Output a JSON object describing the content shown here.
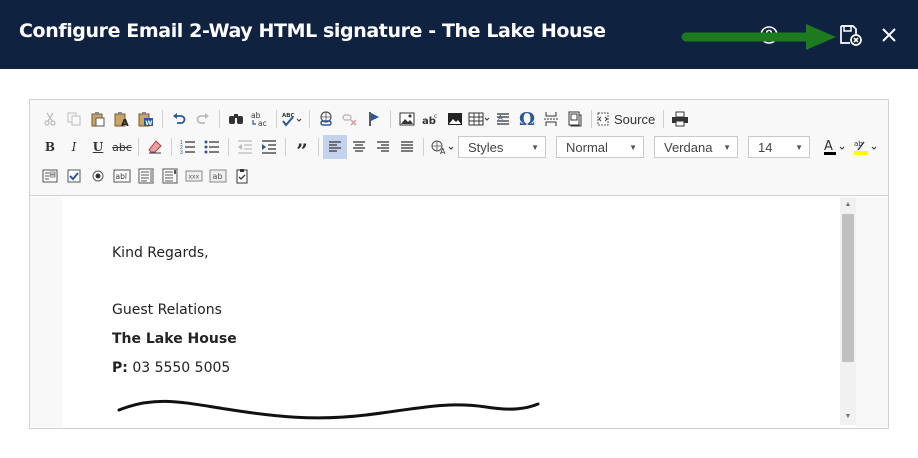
{
  "header": {
    "title": "Configure Email 2-Way HTML signature - The Lake House",
    "background": "#0f2340",
    "icons": [
      "help-icon",
      "save-close-icon",
      "close-icon"
    ],
    "arrow_color": "#1e7a1e"
  },
  "toolbar": {
    "source_label": "Source",
    "styles_label": "Styles",
    "format_label": "Normal",
    "font_label": "Verdana",
    "size_label": "14",
    "paste_word_glyph": "W",
    "abc_glyph": "ABC",
    "spellcheck_glyph": "abc",
    "textfield_glyph": "abl",
    "hidden_glyph": "xxx",
    "button_glyph": "ab"
  },
  "content": {
    "line1": "Kind Regards,",
    "line2": "Guest Relations",
    "line3": "The Lake House",
    "phone_label": "P:",
    "phone_value": "03 5550 5005"
  }
}
